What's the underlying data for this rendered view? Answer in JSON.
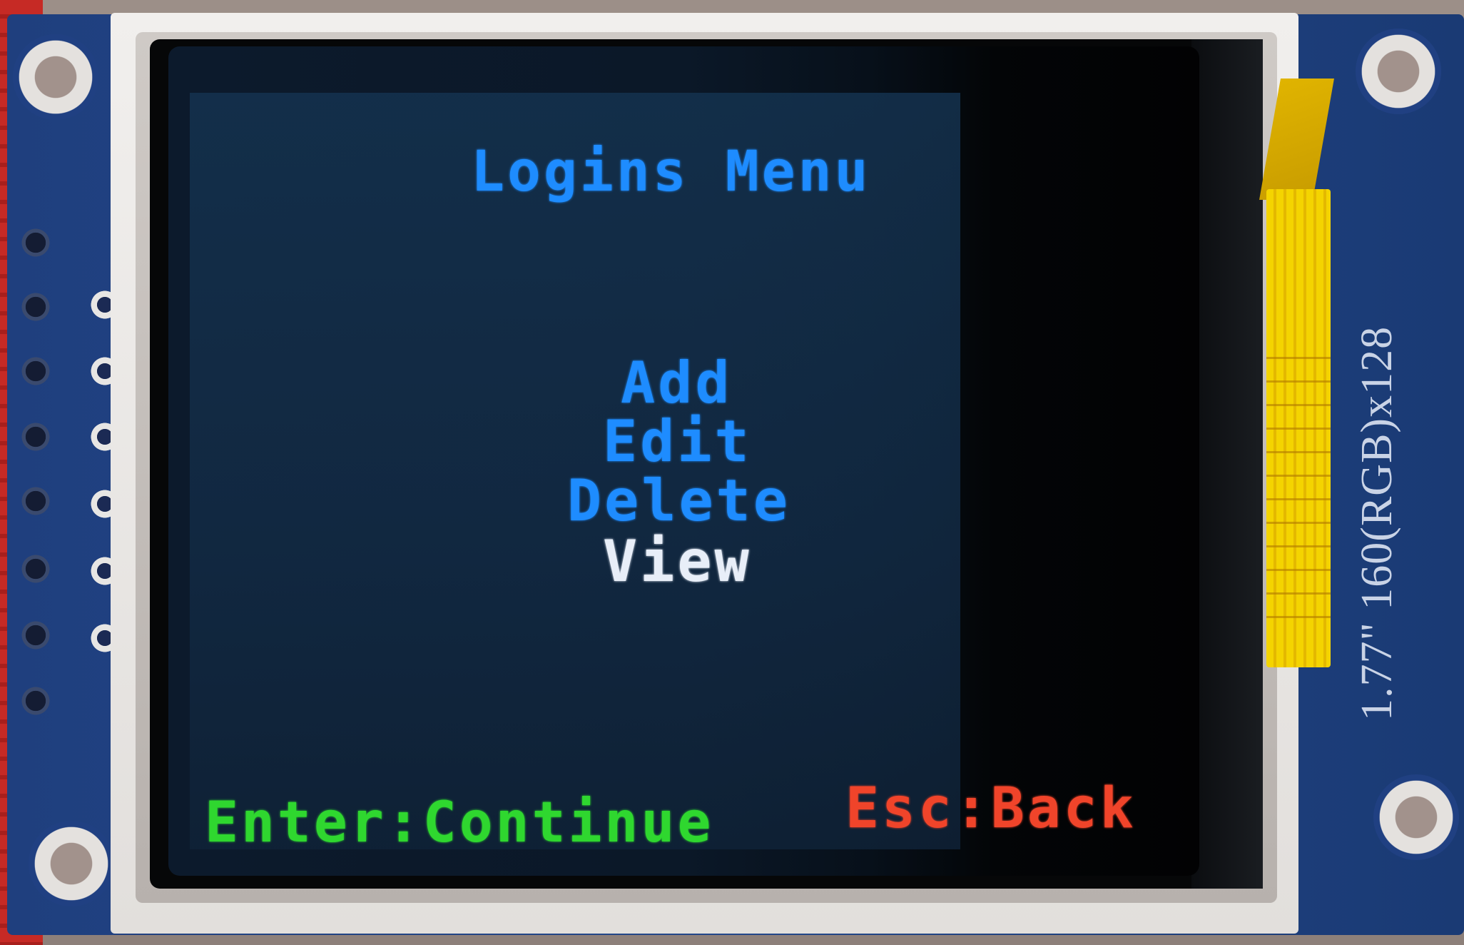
{
  "screen": {
    "title": "Logins Menu",
    "menu_items": [
      {
        "label": "Add",
        "state": "normal"
      },
      {
        "label": "Edit",
        "state": "normal"
      },
      {
        "label": "Delete",
        "state": "normal"
      },
      {
        "label": "View",
        "state": "selected"
      }
    ],
    "footer_left": "Enter:Continue",
    "footer_right": "Esc:Back"
  },
  "module_label": "1.77\" 160(RGB)x128",
  "colors": {
    "title": "#1e8cff",
    "menu_item": "#1e8cff",
    "menu_item_selected": "#e8eef8",
    "footer_left": "#2fd72f",
    "footer_right": "#f0442a",
    "screen_background": "#0f2238",
    "pcb": "#22478a"
  }
}
